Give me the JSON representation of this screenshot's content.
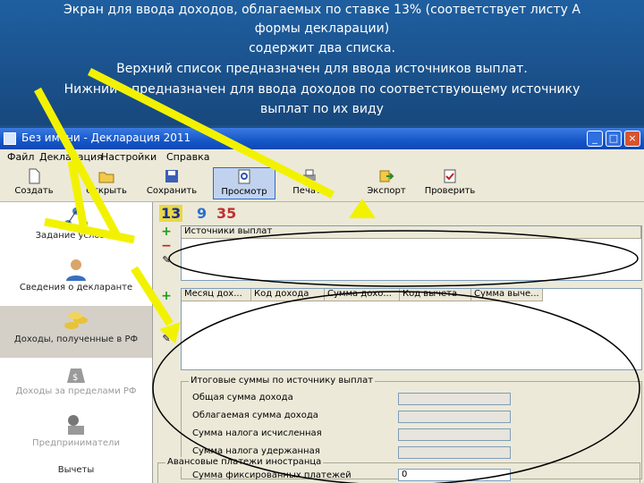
{
  "slide": {
    "lines": [
      "Экран для ввода доходов, облагаемых по ставке 13% (соответствует листу А",
      "формы декларации)",
      "содержит два списка.",
      "Верхний список предназначен для ввода источников выплат.",
      "Нижний – предназначен для ввода доходов по соответствующему источнику",
      "выплат по их виду"
    ]
  },
  "window": {
    "title": "Без имени - Декларация 2011",
    "controls": {
      "minimize": "_",
      "maximize": "□",
      "close": "×"
    }
  },
  "menu": [
    "Файл",
    "Декларация",
    "Настройки",
    "Справка"
  ],
  "toolbar": {
    "create": "Создать",
    "open": "Открыть",
    "save": "Сохранить",
    "preview": "Просмотр",
    "print": "Печать",
    "export": "Экспорт",
    "check": "Проверить"
  },
  "sidebar": {
    "items": [
      "Задание условий",
      "Сведения о декларанте",
      "Доходы, полученные в РФ",
      "Доходы за пределами РФ",
      "Предприниматели",
      "Вычеты"
    ]
  },
  "rates": {
    "r13": "13",
    "r9": "9",
    "r35": "35"
  },
  "upper_list": {
    "header": "Источники выплат"
  },
  "lower_list": {
    "headers": [
      "Месяц дох...",
      "Код дохода",
      "Сумма дохо...",
      "Код вычета",
      "Сумма выче..."
    ]
  },
  "totals": {
    "legend": "Итоговые суммы по источнику выплат",
    "rows": [
      "Общая сумма дохода",
      "Облагаемая сумма дохода",
      "Сумма налога исчисленная",
      "Сумма налога удержанная"
    ]
  },
  "advance": {
    "legend": "Авансовые платежи иностранца",
    "label": "Сумма фиксированных платежей",
    "value": "0"
  },
  "colors": {
    "annotation": "#f2f200",
    "brand_blue": "#1f5fa0"
  }
}
